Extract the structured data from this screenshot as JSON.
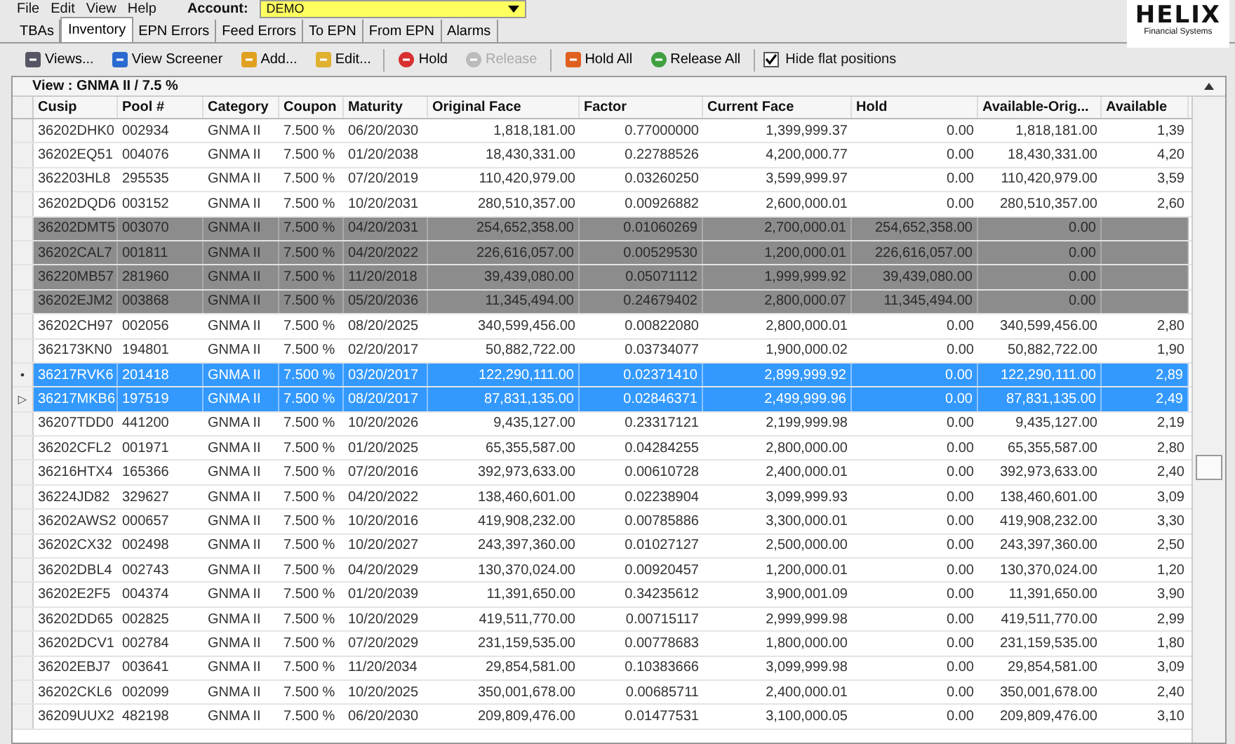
{
  "menu": [
    "File",
    "Edit",
    "View",
    "Help"
  ],
  "account": {
    "label": "Account:",
    "value": "DEMO"
  },
  "logo": {
    "name": "HELIX",
    "tagline": "Financial Systems"
  },
  "tabs": [
    {
      "label": "TBAs",
      "selected": false
    },
    {
      "label": "Inventory",
      "selected": true
    },
    {
      "label": "EPN Errors",
      "selected": false
    },
    {
      "label": "Feed Errors",
      "selected": false
    },
    {
      "label": "To EPN",
      "selected": false
    },
    {
      "label": "From EPN",
      "selected": false
    },
    {
      "label": "Alarms",
      "selected": false
    }
  ],
  "toolbar": [
    {
      "kind": "views",
      "label": "Views...",
      "disabled": false
    },
    {
      "kind": "screener",
      "label": "View Screener",
      "disabled": false
    },
    {
      "kind": "add",
      "label": "Add...",
      "disabled": false
    },
    {
      "kind": "edit",
      "label": "Edit...",
      "disabled": false
    },
    {
      "kind": "hold",
      "label": "Hold",
      "disabled": false
    },
    {
      "kind": "release",
      "label": "Release",
      "disabled": true
    },
    {
      "kind": "holdall",
      "label": "Hold All",
      "disabled": false
    },
    {
      "kind": "releaseall",
      "label": "Release All",
      "disabled": false
    },
    {
      "kind": "checkbox",
      "label": "Hide flat positions",
      "checked": true
    }
  ],
  "view_title": "View : GNMA II / 7.5 %",
  "table": {
    "columns": [
      "Cusip",
      "Pool #",
      "Category",
      "Coupon",
      "Maturity",
      "Original Face",
      "Factor",
      "Current Face",
      "Hold",
      "Available-Orig...",
      "Available"
    ],
    "rows": [
      {
        "held": false,
        "selected": false,
        "cells": [
          "36202DHK0",
          "002934",
          "GNMA II",
          "7.500 %",
          "06/20/2030",
          "1,818,181.00",
          "0.77000000",
          "1,399,999.37",
          "0.00",
          "1,818,181.00",
          "1,39"
        ]
      },
      {
        "held": false,
        "selected": false,
        "cells": [
          "36202EQ51",
          "004076",
          "GNMA II",
          "7.500 %",
          "01/20/2038",
          "18,430,331.00",
          "0.22788526",
          "4,200,000.77",
          "0.00",
          "18,430,331.00",
          "4,20"
        ]
      },
      {
        "held": false,
        "selected": false,
        "cells": [
          "362203HL8",
          "295535",
          "GNMA II",
          "7.500 %",
          "07/20/2019",
          "110,420,979.00",
          "0.03260250",
          "3,599,999.97",
          "0.00",
          "110,420,979.00",
          "3,59"
        ]
      },
      {
        "held": false,
        "selected": false,
        "cells": [
          "36202DQD6",
          "003152",
          "GNMA II",
          "7.500 %",
          "10/20/2031",
          "280,510,357.00",
          "0.00926882",
          "2,600,000.01",
          "0.00",
          "280,510,357.00",
          "2,60"
        ]
      },
      {
        "held": true,
        "selected": false,
        "cells": [
          "36202DMT5",
          "003070",
          "GNMA II",
          "7.500 %",
          "04/20/2031",
          "254,652,358.00",
          "0.01060269",
          "2,700,000.01",
          "254,652,358.00",
          "0.00",
          ""
        ]
      },
      {
        "held": true,
        "selected": false,
        "cells": [
          "36202CAL7",
          "001811",
          "GNMA II",
          "7.500 %",
          "04/20/2022",
          "226,616,057.00",
          "0.00529530",
          "1,200,000.01",
          "226,616,057.00",
          "0.00",
          ""
        ]
      },
      {
        "held": true,
        "selected": false,
        "cells": [
          "36220MB57",
          "281960",
          "GNMA II",
          "7.500 %",
          "11/20/2018",
          "39,439,080.00",
          "0.05071112",
          "1,999,999.92",
          "39,439,080.00",
          "0.00",
          ""
        ]
      },
      {
        "held": true,
        "selected": false,
        "cells": [
          "36202EJM2",
          "003868",
          "GNMA II",
          "7.500 %",
          "05/20/2036",
          "11,345,494.00",
          "0.24679402",
          "2,800,000.07",
          "11,345,494.00",
          "0.00",
          ""
        ]
      },
      {
        "held": false,
        "selected": false,
        "cells": [
          "36202CH97",
          "002056",
          "GNMA II",
          "7.500 %",
          "08/20/2025",
          "340,599,456.00",
          "0.00822080",
          "2,800,000.01",
          "0.00",
          "340,599,456.00",
          "2,80"
        ]
      },
      {
        "held": false,
        "selected": false,
        "cells": [
          "362173KN0",
          "194801",
          "GNMA II",
          "7.500 %",
          "02/20/2017",
          "50,882,722.00",
          "0.03734077",
          "1,900,000.02",
          "0.00",
          "50,882,722.00",
          "1,90"
        ]
      },
      {
        "held": false,
        "selected": true,
        "marker": "•",
        "cells": [
          "36217RVK6",
          "201418",
          "GNMA II",
          "7.500 %",
          "03/20/2017",
          "122,290,111.00",
          "0.02371410",
          "2,899,999.92",
          "0.00",
          "122,290,111.00",
          "2,89"
        ]
      },
      {
        "held": false,
        "selected": true,
        "marker": "▷",
        "cells": [
          "36217MKB6",
          "197519",
          "GNMA II",
          "7.500 %",
          "08/20/2017",
          "87,831,135.00",
          "0.02846371",
          "2,499,999.96",
          "0.00",
          "87,831,135.00",
          "2,49"
        ]
      },
      {
        "held": false,
        "selected": false,
        "cells": [
          "36207TDD0",
          "441200",
          "GNMA II",
          "7.500 %",
          "10/20/2026",
          "9,435,127.00",
          "0.23317121",
          "2,199,999.98",
          "0.00",
          "9,435,127.00",
          "2,19"
        ]
      },
      {
        "held": false,
        "selected": false,
        "cells": [
          "36202CFL2",
          "001971",
          "GNMA II",
          "7.500 %",
          "01/20/2025",
          "65,355,587.00",
          "0.04284255",
          "2,800,000.00",
          "0.00",
          "65,355,587.00",
          "2,80"
        ]
      },
      {
        "held": false,
        "selected": false,
        "cells": [
          "36216HTX4",
          "165366",
          "GNMA II",
          "7.500 %",
          "07/20/2016",
          "392,973,633.00",
          "0.00610728",
          "2,400,000.01",
          "0.00",
          "392,973,633.00",
          "2,40"
        ]
      },
      {
        "held": false,
        "selected": false,
        "cells": [
          "36224JD82",
          "329627",
          "GNMA II",
          "7.500 %",
          "04/20/2022",
          "138,460,601.00",
          "0.02238904",
          "3,099,999.93",
          "0.00",
          "138,460,601.00",
          "3,09"
        ]
      },
      {
        "held": false,
        "selected": false,
        "cells": [
          "36202AWS2",
          "000657",
          "GNMA II",
          "7.500 %",
          "10/20/2016",
          "419,908,232.00",
          "0.00785886",
          "3,300,000.01",
          "0.00",
          "419,908,232.00",
          "3,30"
        ]
      },
      {
        "held": false,
        "selected": false,
        "cells": [
          "36202CX32",
          "002498",
          "GNMA II",
          "7.500 %",
          "10/20/2027",
          "243,397,360.00",
          "0.01027127",
          "2,500,000.00",
          "0.00",
          "243,397,360.00",
          "2,50"
        ]
      },
      {
        "held": false,
        "selected": false,
        "cells": [
          "36202DBL4",
          "002743",
          "GNMA II",
          "7.500 %",
          "04/20/2029",
          "130,370,024.00",
          "0.00920457",
          "1,200,000.01",
          "0.00",
          "130,370,024.00",
          "1,20"
        ]
      },
      {
        "held": false,
        "selected": false,
        "cells": [
          "36202E2F5",
          "004374",
          "GNMA II",
          "7.500 %",
          "01/20/2039",
          "11,391,650.00",
          "0.34235612",
          "3,900,001.09",
          "0.00",
          "11,391,650.00",
          "3,90"
        ]
      },
      {
        "held": false,
        "selected": false,
        "cells": [
          "36202DD65",
          "002825",
          "GNMA II",
          "7.500 %",
          "10/20/2029",
          "419,511,770.00",
          "0.00715117",
          "2,999,999.98",
          "0.00",
          "419,511,770.00",
          "2,99"
        ]
      },
      {
        "held": false,
        "selected": false,
        "cells": [
          "36202DCV1",
          "002784",
          "GNMA II",
          "7.500 %",
          "07/20/2029",
          "231,159,535.00",
          "0.00778683",
          "1,800,000.00",
          "0.00",
          "231,159,535.00",
          "1,80"
        ]
      },
      {
        "held": false,
        "selected": false,
        "cells": [
          "36202EBJ7",
          "003641",
          "GNMA II",
          "7.500 %",
          "11/20/2034",
          "29,854,581.00",
          "0.10383666",
          "3,099,999.98",
          "0.00",
          "29,854,581.00",
          "3,09"
        ]
      },
      {
        "held": false,
        "selected": false,
        "cells": [
          "36202CKL6",
          "002099",
          "GNMA II",
          "7.500 %",
          "10/20/2025",
          "350,001,678.00",
          "0.00685711",
          "2,400,000.01",
          "0.00",
          "350,001,678.00",
          "2,40"
        ]
      },
      {
        "held": false,
        "selected": false,
        "cells": [
          "36209UUX2",
          "482198",
          "GNMA II",
          "7.500 %",
          "06/20/2030",
          "209,809,476.00",
          "0.01477531",
          "3,100,000.05",
          "0.00",
          "209,809,476.00",
          "3,10"
        ]
      }
    ]
  }
}
